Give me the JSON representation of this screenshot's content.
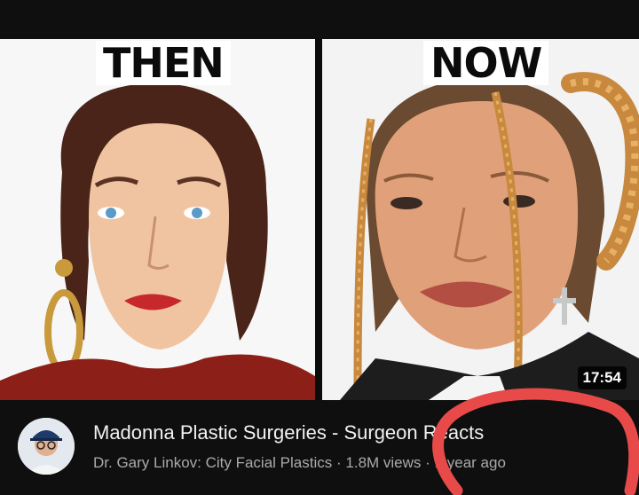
{
  "thumbnail": {
    "left_caption": "THEN",
    "right_caption": "NOW",
    "duration": "17:54"
  },
  "video": {
    "title": "Madonna Plastic Surgeries - Surgeon Reacts",
    "channel": "Dr. Gary Linkov: City Facial Plastics",
    "separator": "·",
    "views": "1.8M views",
    "age": "1 year ago"
  },
  "colors": {
    "background": "#0f0f0f",
    "title_text": "#f1f1f1",
    "sub_text": "#aaaaaa",
    "annotation": "#e84a4a"
  },
  "icons": {
    "more": "more-vert-icon"
  }
}
